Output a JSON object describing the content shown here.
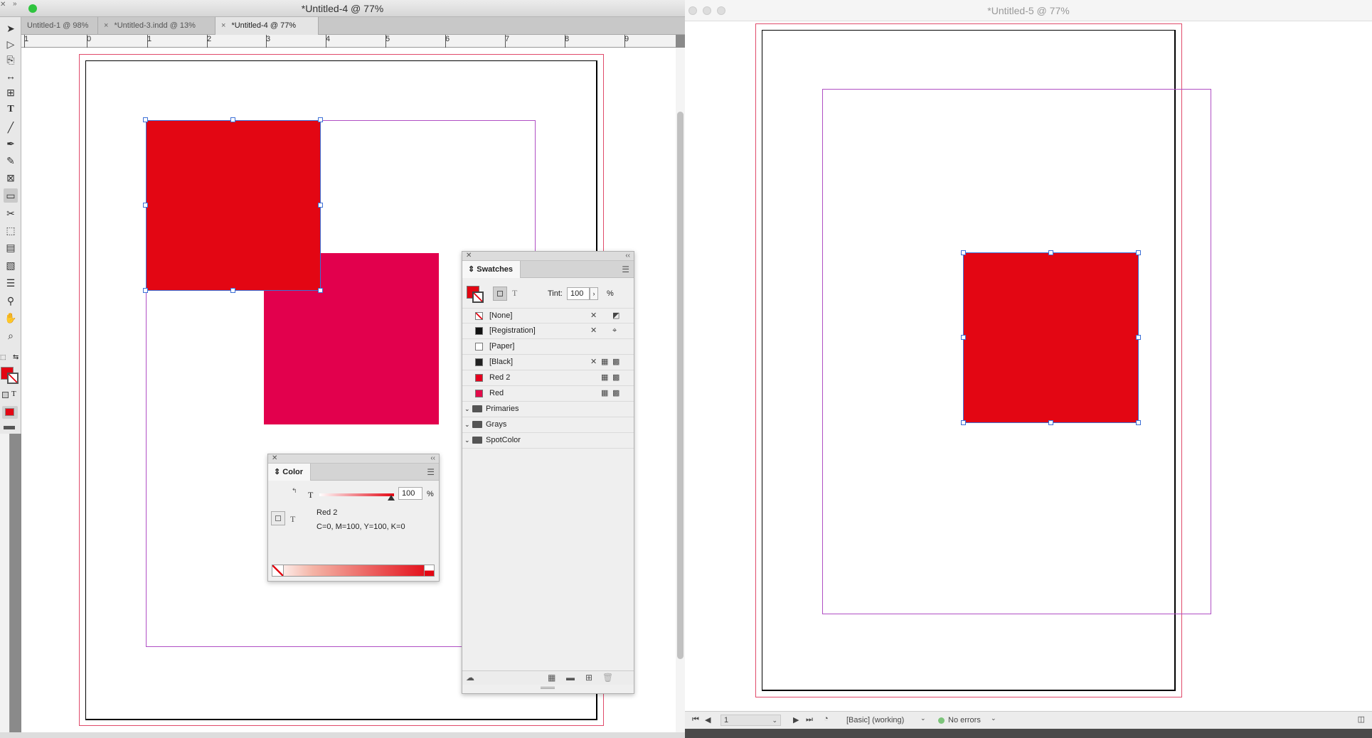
{
  "left_window": {
    "title": "*Untitled-4 @ 77%",
    "tabs": [
      {
        "label": "Untitled-1 @ 98%",
        "close": ""
      },
      {
        "label": "*Untitled-3.indd @ 13%",
        "close": "×"
      },
      {
        "label": "*Untitled-4 @ 77%",
        "close": "×"
      }
    ],
    "ruler_ticks": [
      "1",
      "0",
      "1",
      "2",
      "3",
      "4",
      "5",
      "6",
      "7",
      "8",
      "9"
    ]
  },
  "swatches_panel": {
    "title": "Swatches",
    "tint_label": "Tint:",
    "tint_value": "100",
    "tint_unit": "%",
    "fill_label": "T",
    "swatches": [
      {
        "name": "[None]",
        "chip": "none"
      },
      {
        "name": "[Registration]",
        "chip": "#111111"
      },
      {
        "name": "[Paper]",
        "chip": "#ffffff"
      },
      {
        "name": "[Black]",
        "chip": "#222222"
      },
      {
        "name": "Red 2",
        "chip": "#e5001f"
      },
      {
        "name": "Red",
        "chip": "#e30b4a"
      }
    ],
    "groups": [
      "Primaries",
      "Grays",
      "SpotColor"
    ]
  },
  "color_panel": {
    "title": "Color",
    "tint_letter": "T",
    "tint_value": "100",
    "tint_unit": "%",
    "swatch_name": "Red 2",
    "cmyk": "C=0, M=100, Y=100, K=0",
    "text_letter": "T"
  },
  "right_window": {
    "title": "*Untitled-5 @ 77%",
    "page_number": "1",
    "style": "[Basic] (working)",
    "preflight": "No errors"
  },
  "colors": {
    "red2": "#e30613",
    "red": "#e2004d",
    "margin": "#b04fc4",
    "bleed": "#e04a6a",
    "selection": "#3b6fd6"
  }
}
